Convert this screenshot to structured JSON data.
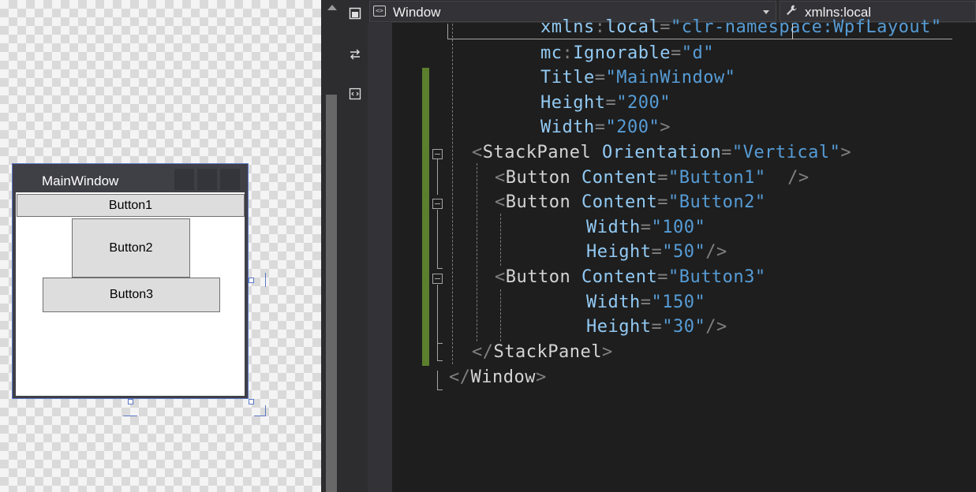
{
  "designer": {
    "window_title": "MainWindow",
    "buttons": [
      {
        "label": "Button1"
      },
      {
        "label": "Button2"
      },
      {
        "label": "Button3"
      }
    ]
  },
  "nav_bar": {
    "element_dropdown": "Window",
    "member_dropdown": "xmlns:local"
  },
  "toolbar": {
    "icons": [
      "designer-pane-icon",
      "swap-panes-icon",
      "xaml-pane-icon"
    ]
  },
  "code": {
    "line0": {
      "indent": "      ",
      "ns": "xmlns",
      "sep": ":",
      "att": "local",
      "eq": "=",
      "val": "\"clr-namespace:WpfLayout\""
    },
    "line1": {
      "ns": "mc",
      "sep": ":",
      "att": "Ignorable",
      "eq": "=",
      "val": "\"d\""
    },
    "line2": {
      "att": "Title",
      "eq": "=",
      "val": "\"MainWindow\""
    },
    "line3": {
      "att": "Height",
      "eq": "=",
      "val": "\"200\""
    },
    "line4": {
      "att": "Width",
      "eq": "=",
      "val": "\"200\"",
      "close": ">"
    },
    "line5": {
      "open": "<",
      "ele": "StackPanel",
      "att": "Orientation",
      "eq": "=",
      "val": "\"Vertical\"",
      "close": ">"
    },
    "line6": {
      "open": "<",
      "ele": "Button",
      "att": "Content",
      "eq": "=",
      "val": "\"Button1\"",
      "close": "/>"
    },
    "line7": {
      "open": "<",
      "ele": "Button",
      "att": "Content",
      "eq": "=",
      "val": "\"Button2\""
    },
    "line8": {
      "att": "Width",
      "eq": "=",
      "val": "\"100\""
    },
    "line9": {
      "att": "Height",
      "eq": "=",
      "val": "\"50\"",
      "close": "/>"
    },
    "line10": {
      "open": "<",
      "ele": "Button",
      "att": "Content",
      "eq": "=",
      "val": "\"Button3\""
    },
    "line11": {
      "att": "Width",
      "eq": "=",
      "val": "\"150\""
    },
    "line12": {
      "att": "Height",
      "eq": "=",
      "val": "\"30\"",
      "close": "/>"
    },
    "line13": {
      "open": "</",
      "ele": "StackPanel",
      "close": ">"
    },
    "line14": {
      "open": "</",
      "ele": "Window",
      "close": ">"
    }
  },
  "colors": {
    "tag": "#d4d4d4",
    "attribute": "#92caf4",
    "string": "#569cd6",
    "punctuation": "#808080",
    "change_bar": "#5b7f2d",
    "selection_border": "#5b78c7"
  }
}
